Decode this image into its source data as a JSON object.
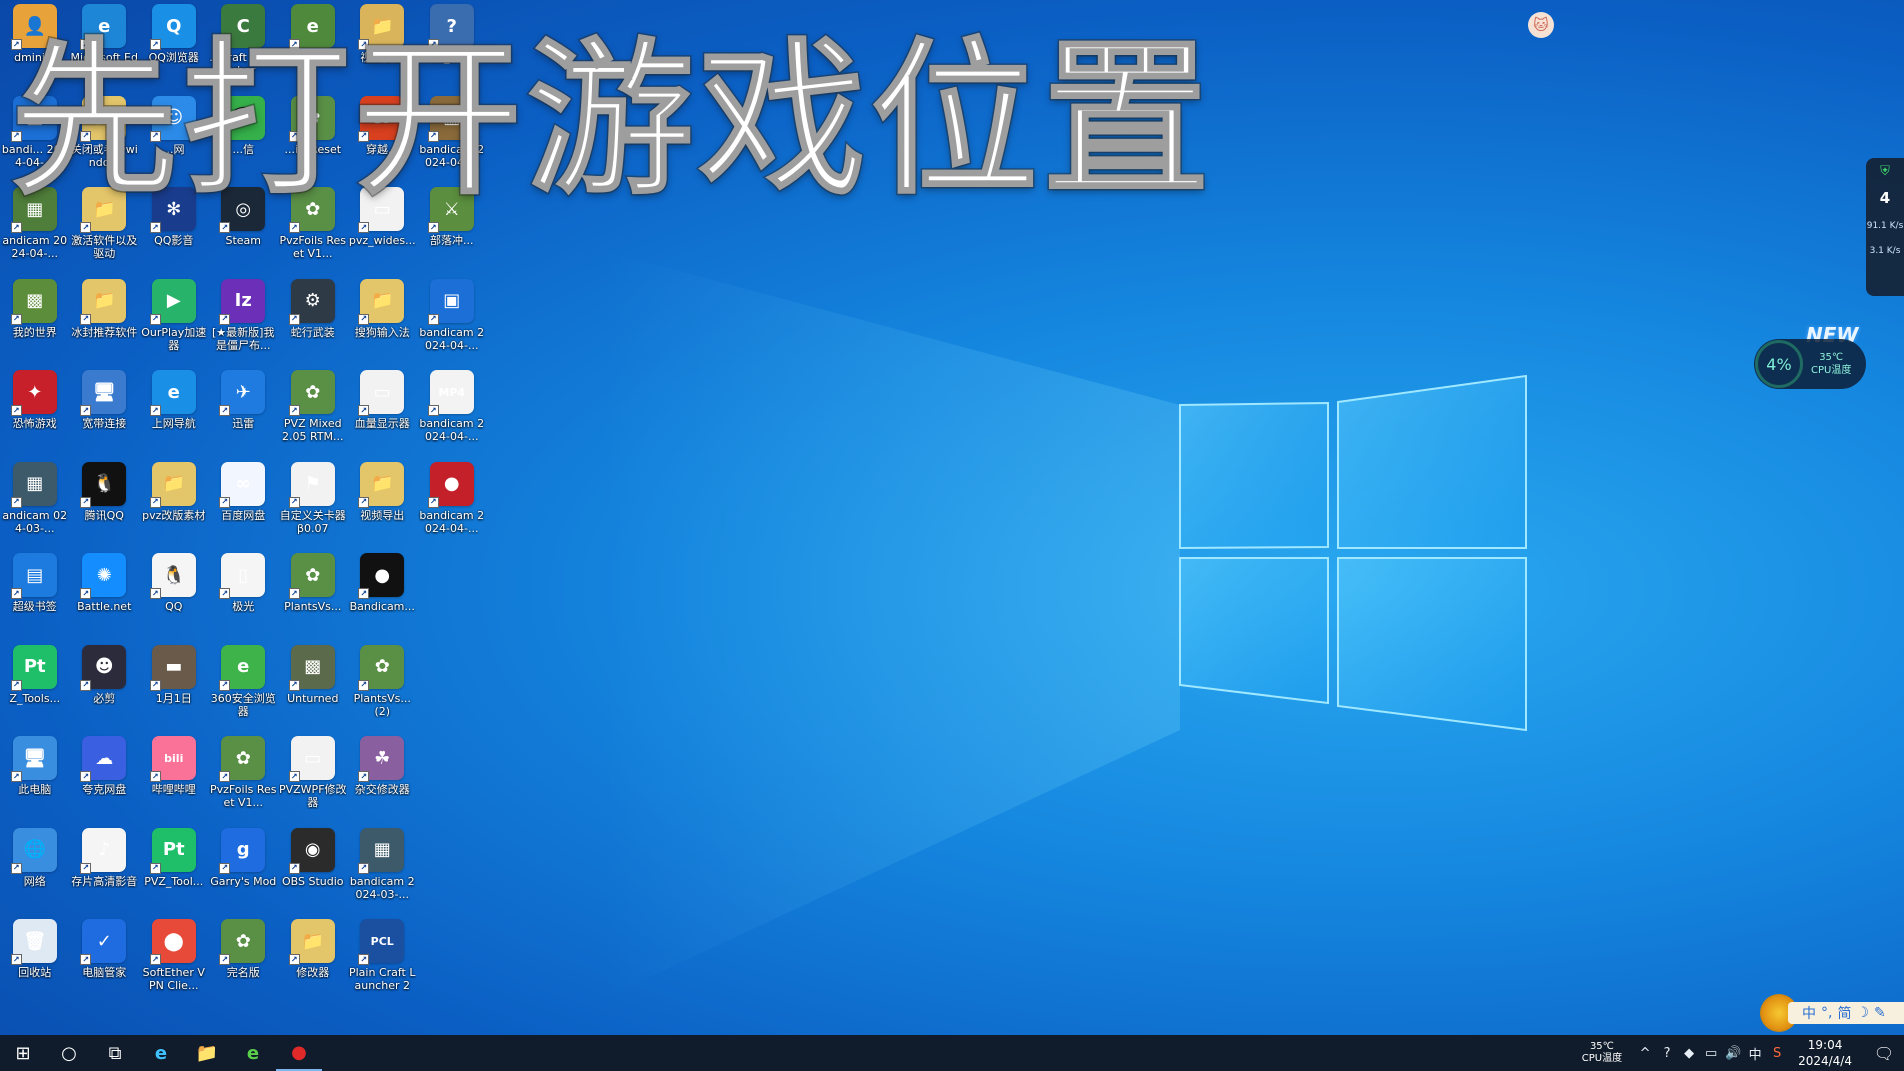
{
  "overlay_title": "先打开游戏位置",
  "desktop_icons": [
    {
      "label": "dmini...",
      "color": "#e8a23a",
      "glyph": "👤"
    },
    {
      "label": "Microsoft Edge",
      "color": "#1e86d6",
      "glyph": "e"
    },
    {
      "label": "QQ浏览器",
      "color": "#1a8fe6",
      "glyph": "Q"
    },
    {
      "label": "...Craft Launcher",
      "color": "#3b7a3f",
      "glyph": "C"
    },
    {
      "label": "e版...",
      "color": "#4f8a3c",
      "glyph": "e"
    },
    {
      "label": "视频导出",
      "color": "#d9b45a",
      "glyph": "📁"
    },
    {
      "label": "VZ_Help",
      "color": "#3a6cb0",
      "glyph": "?"
    },
    {
      "label": "bandi... 2024-04-...",
      "color": "#1b6fd6",
      "glyph": "▣"
    },
    {
      "label": "关闭或者开windo...",
      "color": "#e3c56a",
      "glyph": "📁"
    },
    {
      "label": "...网",
      "color": "#2c8be8",
      "glyph": "☺"
    },
    {
      "label": "...信",
      "color": "#35b04a",
      "glyph": "💬"
    },
    {
      "label": "...ils Reset",
      "color": "#5a8f46",
      "glyph": "✿"
    },
    {
      "label": "穿越...",
      "color": "#d8401f",
      "glyph": "CF"
    },
    {
      "label": "bandicam 2024-04-...",
      "color": "#8a6a3a",
      "glyph": "▦"
    },
    {
      "label": "andicam 2024-04-...",
      "color": "#4f7d3a",
      "glyph": "▦"
    },
    {
      "label": "激活软件以及驱动",
      "color": "#e3c56a",
      "glyph": "📁"
    },
    {
      "label": "QQ影音",
      "color": "#1a3c8c",
      "glyph": "✻"
    },
    {
      "label": "Steam",
      "color": "#1b2838",
      "glyph": "◎"
    },
    {
      "label": "PvzFoils Reset V1...",
      "color": "#5a8f46",
      "glyph": "✿"
    },
    {
      "label": "pvz_wides...",
      "color": "#f2f2f2",
      "glyph": "▭"
    },
    {
      "label": "部落冲...",
      "color": "#5b8e3e",
      "glyph": "⚔"
    },
    {
      "label": "我的世界",
      "color": "#5c8d3a",
      "glyph": "▩"
    },
    {
      "label": "冰封推荐软件",
      "color": "#e3c56a",
      "glyph": "📁"
    },
    {
      "label": "OurPlay加速器",
      "color": "#27b36a",
      "glyph": "▶"
    },
    {
      "label": "[★最新版]我是僵尸布...",
      "color": "#6b2fb8",
      "glyph": "Iz"
    },
    {
      "label": "蛇行武装",
      "color": "#2e3a46",
      "glyph": "⚙"
    },
    {
      "label": "搜狗输入法",
      "color": "#e3c56a",
      "glyph": "📁"
    },
    {
      "label": "bandicam 2024-04-...",
      "color": "#1b6fd6",
      "glyph": "▣"
    },
    {
      "label": "恐怖游戏",
      "color": "#c8202a",
      "glyph": "✦"
    },
    {
      "label": "宽带连接",
      "color": "#3a7bd0",
      "glyph": "🖥"
    },
    {
      "label": "上网导航",
      "color": "#1a8fe6",
      "glyph": "e"
    },
    {
      "label": "迅雷",
      "color": "#1f7be0",
      "glyph": "✈"
    },
    {
      "label": "PVZ Mixed 2.05 RTM...",
      "color": "#5a8f46",
      "glyph": "✿"
    },
    {
      "label": "血量显示器",
      "color": "#f2f2f2",
      "glyph": "▭"
    },
    {
      "label": "bandicam 2024-04-...",
      "color": "#f3f3f3",
      "glyph": "MP4"
    },
    {
      "label": "andicam 024-03-...",
      "color": "#3d5a6a",
      "glyph": "▦"
    },
    {
      "label": "腾讯QQ",
      "color": "#111111",
      "glyph": "🐧"
    },
    {
      "label": "pvz改版素材",
      "color": "#e3c56a",
      "glyph": "📁"
    },
    {
      "label": "百度网盘",
      "color": "#f2f7ff",
      "glyph": "∞"
    },
    {
      "label": "自定义关卡器β0.07",
      "color": "#f2f2f2",
      "glyph": "⚑"
    },
    {
      "label": "视频导出",
      "color": "#e3c56a",
      "glyph": "📁"
    },
    {
      "label": "bandicam 2024-04-...",
      "color": "#c4202a",
      "glyph": "●"
    },
    {
      "label": "超级书签",
      "color": "#1d7be0",
      "glyph": "▤"
    },
    {
      "label": "Battle.net",
      "color": "#148eff",
      "glyph": "✺"
    },
    {
      "label": "QQ",
      "color": "#f5f5f5",
      "glyph": "🐧"
    },
    {
      "label": "极光",
      "color": "#f5f5f5",
      "glyph": "▯"
    },
    {
      "label": "PlantsVs...",
      "color": "#5a8f46",
      "glyph": "✿"
    },
    {
      "label": "Bandicam...",
      "color": "#111111",
      "glyph": "●"
    },
    {
      "label": "",
      "color": "",
      "glyph": ""
    },
    {
      "label": "Z_Tools...",
      "color": "#1fbf6a",
      "glyph": "Pt"
    },
    {
      "label": "必剪",
      "color": "#2b2b3b",
      "glyph": "☻"
    },
    {
      "label": "1月1日",
      "color": "#6a5a4a",
      "glyph": "▬"
    },
    {
      "label": "360安全浏览器",
      "color": "#3db34a",
      "glyph": "e"
    },
    {
      "label": "Unturned",
      "color": "#5a6a4a",
      "glyph": "▩"
    },
    {
      "label": "PlantsVs... (2)",
      "color": "#5a8f46",
      "glyph": "✿"
    },
    {
      "label": "",
      "color": "",
      "glyph": ""
    },
    {
      "label": "此电脑",
      "color": "#3a8ee0",
      "glyph": "🖥"
    },
    {
      "label": "夸克网盘",
      "color": "#3a5fe0",
      "glyph": "☁"
    },
    {
      "label": "哔哩哔哩",
      "color": "#fb7299",
      "glyph": "bili"
    },
    {
      "label": "PvzFoils Reset V1...",
      "color": "#5a8f46",
      "glyph": "✿"
    },
    {
      "label": "PVZWPF修改器",
      "color": "#f2f2f2",
      "glyph": "▭"
    },
    {
      "label": "杂交修改器",
      "color": "#8a5fa0",
      "glyph": "☘"
    },
    {
      "label": "",
      "color": "",
      "glyph": ""
    },
    {
      "label": "网络",
      "color": "#3a8ee0",
      "glyph": "🌐"
    },
    {
      "label": "存片高清影音",
      "color": "#f5f5f5",
      "glyph": "♪"
    },
    {
      "label": "PVZ_Tool...",
      "color": "#1fbf6a",
      "glyph": "Pt"
    },
    {
      "label": "Garry's Mod",
      "color": "#1f6be0",
      "glyph": "g"
    },
    {
      "label": "OBS Studio",
      "color": "#2b2b2b",
      "glyph": "◉"
    },
    {
      "label": "bandicam 2024-03-...",
      "color": "#3d5a6a",
      "glyph": "▦"
    },
    {
      "label": "",
      "color": "",
      "glyph": ""
    },
    {
      "label": "回收站",
      "color": "#dfe9f3",
      "glyph": "🗑"
    },
    {
      "label": "电脑管家",
      "color": "#1f6be0",
      "glyph": "✓"
    },
    {
      "label": "SoftEther VPN Clie...",
      "color": "#e84a3a",
      "glyph": "⬤"
    },
    {
      "label": "完名版",
      "color": "#5a8f46",
      "glyph": "✿"
    },
    {
      "label": "修改器",
      "color": "#e3c56a",
      "glyph": "📁"
    },
    {
      "label": "Plain Craft Launcher 2",
      "color": "#1b4fa0",
      "glyph": "PCL"
    },
    {
      "label": "",
      "color": "",
      "glyph": ""
    }
  ],
  "monitor_widget": {
    "cpu_percent": "4",
    "upload": "91.1 K/s",
    "download": "3.1 K/s"
  },
  "cpu_gauge": {
    "badge": "NEW",
    "percent": "4%",
    "temp": "35℃",
    "temp_label": "CPU温度"
  },
  "ime": {
    "items": [
      "中",
      "°,",
      "简",
      "☽",
      "✎"
    ]
  },
  "taskbar": {
    "apps": [
      {
        "name": "start",
        "glyph": "⊞"
      },
      {
        "name": "search",
        "glyph": "○"
      },
      {
        "name": "task-view",
        "glyph": "⧉"
      },
      {
        "name": "edge",
        "glyph": "e"
      },
      {
        "name": "file-explorer",
        "glyph": "📁"
      },
      {
        "name": "360-browser",
        "glyph": "e"
      },
      {
        "name": "bandicam",
        "glyph": "●"
      }
    ],
    "cpu_temp": "35℃",
    "cpu_temp_label": "CPU温度",
    "tray_icons": [
      "^",
      "?",
      "◆",
      "▭",
      "🔊",
      "中",
      "S"
    ],
    "time": "19:04",
    "date": "2024/4/4"
  }
}
